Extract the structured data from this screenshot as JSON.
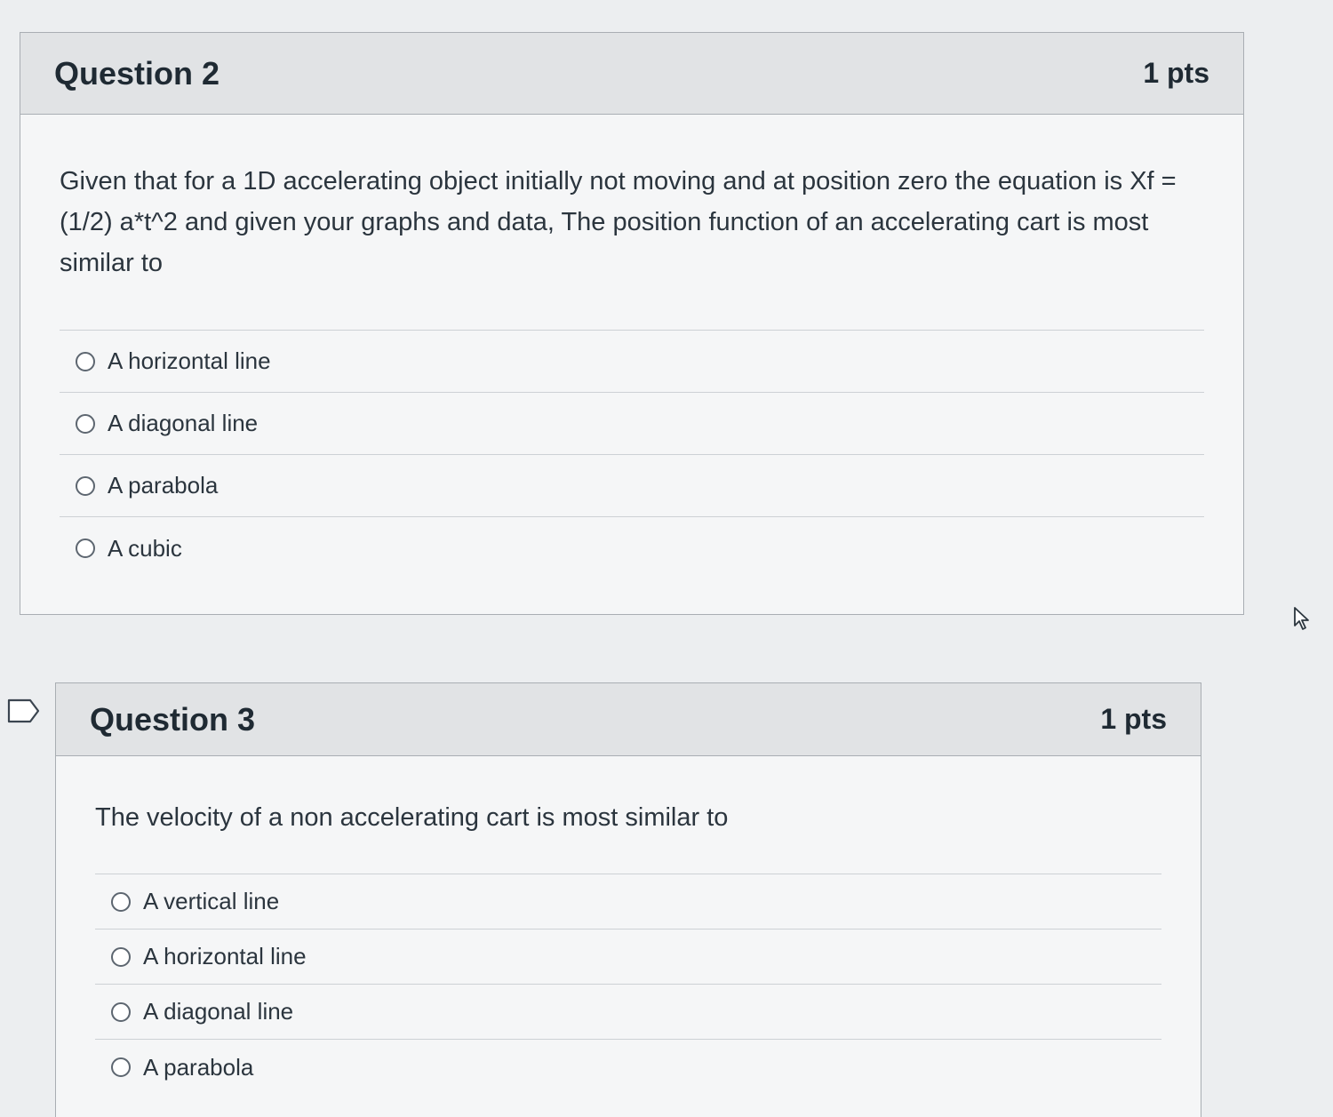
{
  "question2": {
    "title": "Question 2",
    "points": "1 pts",
    "text": "Given that for a 1D accelerating object initially not moving and at position zero the equation is Xf = (1/2) a*t^2 and given your graphs and data, The position function of an accelerating cart is most similar to",
    "answers": [
      "A horizontal line",
      "A diagonal line",
      "A parabola",
      "A cubic"
    ]
  },
  "question3": {
    "title": "Question 3",
    "points": "1 pts",
    "text": "The velocity of a non accelerating cart is most similar to",
    "answers": [
      "A vertical line",
      "A horizontal line",
      "A diagonal line",
      "A parabola"
    ]
  },
  "icons": {
    "bookmark": "bookmark-flag-icon",
    "cursor": "mouse-pointer-icon"
  }
}
